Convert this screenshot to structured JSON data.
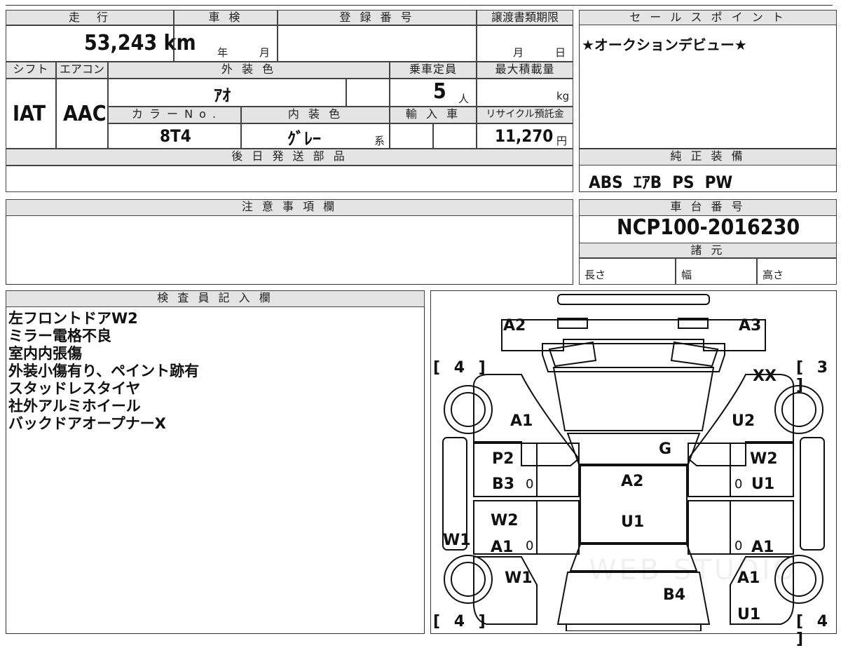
{
  "vehicle_info": {
    "mileage_header": "走　行",
    "mileage": "53,243 km",
    "inspection_header": "車 検",
    "inspection_year_unit": "年",
    "inspection_month_unit": "月",
    "registration_header": "登 録 番 号",
    "transfer_deadline_header": "譲渡書類期限",
    "transfer_month_unit": "月",
    "transfer_day_unit": "日",
    "shift_header": "シフト",
    "shift": "IAT",
    "aircon_header": "エアコン",
    "aircon": "AAC",
    "exterior_color_header": "外 装 色",
    "exterior_color": "ｱｵ",
    "capacity_header": "乗車定員",
    "capacity": "5",
    "capacity_unit": "人",
    "max_load_header": "最大積載量",
    "max_load_unit": "kg",
    "color_no_header": "カ ラ ー N o .",
    "color_no": "8T4",
    "interior_color_header": "内 装 色",
    "interior_color": "ｸﾞﾚｰ",
    "interior_suffix": "系",
    "import_header": "輸 入 車",
    "recycle_header": "リサイクル預託金",
    "recycle_fee": "11,270",
    "recycle_unit": "円",
    "later_parts_header": "後 日 発 送 部 品"
  },
  "sales_points": {
    "header": "セ ー ル ス ポ イ ン ト",
    "text": "★オークションデビュー★"
  },
  "standard_equipment": {
    "header": "純 正 装 備",
    "text": "ABS  ｴｱB  PS  PW"
  },
  "notes": {
    "header": "注 意 事 項 欄"
  },
  "chassis": {
    "header": "車 台 番 号",
    "number": "NCP100-2016230",
    "specs_header": "諸 元",
    "length_label": "長さ",
    "width_label": "幅",
    "height_label": "高さ"
  },
  "inspector": {
    "header": "検 査 員 記 入 欄",
    "lines": [
      "左フロントドアW2",
      "ミラー電格不良",
      "室内内張傷",
      "外装小傷有り、ペイント跡有",
      "スタッドレスタイヤ",
      "社外アルミホイール",
      "バックドアオープナーX"
    ]
  },
  "diagram": {
    "tire_front_left": "[ 4 ]",
    "tire_front_right": "[ 3 ]",
    "tire_rear_left": "[ 4 ]",
    "tire_rear_right": "[ 4 ]",
    "labels": {
      "front_bumper_left": "A2",
      "front_bumper_right": "A3",
      "fender_right_front": "XX",
      "fender_left": "A1",
      "fender_right": "U2",
      "windshield": "G",
      "door_fl_1": "P2",
      "door_fl_2": "B3",
      "door_fr_1": "W2",
      "door_fr_2": "U1",
      "roof_1": "A2",
      "roof_2": "U1",
      "door_rl_1": "W2",
      "door_rl_2": "A1",
      "door_rr": "A1",
      "sill_left": "W1",
      "rear_fender_left": "W1",
      "rear_fender_right": "A1",
      "back": "B4",
      "rear_right_bottom": "U1"
    },
    "zeros": [
      "0",
      "0",
      "0",
      "0"
    ]
  }
}
